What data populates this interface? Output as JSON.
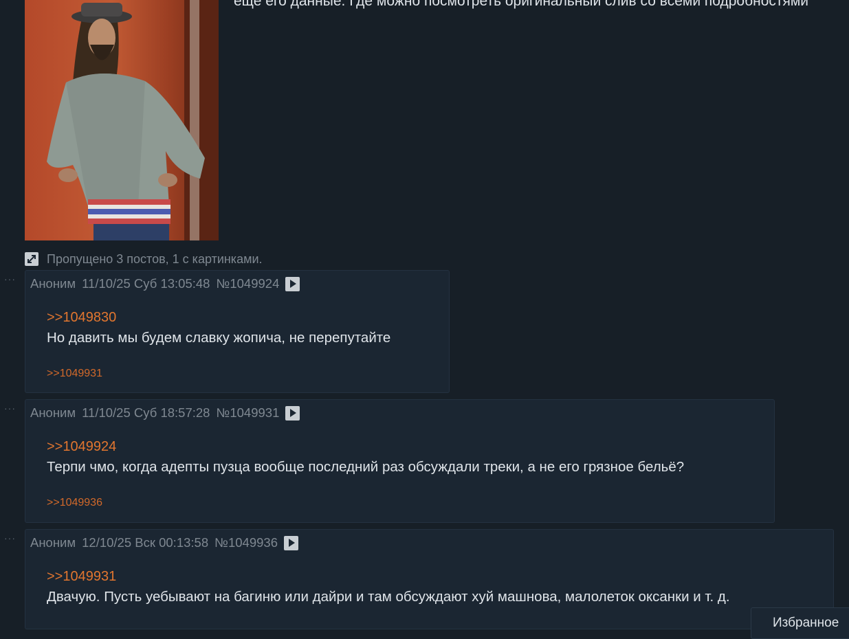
{
  "thread": {
    "op_text": "еще его данные. Где можно посмотреть оригинальный слив со всеми подробностями",
    "omitted_text": "Пропущено 3 постов, 1 с картинками."
  },
  "posts": [
    {
      "author": "Аноним",
      "date": "11/10/25 Суб 13:05:48",
      "number": "№1049924",
      "quote": ">>1049830",
      "body": "Но давить мы будем славку жопича, не перепутайте",
      "reply": ">>1049931"
    },
    {
      "author": "Аноним",
      "date": "11/10/25 Суб 18:57:28",
      "number": "№1049931",
      "quote": ">>1049924",
      "body": "Терпи чмо, когда адепты пузца вообще последний раз обсуждали треки, а не его грязное бельё?",
      "reply": ">>1049936"
    },
    {
      "author": "Аноним",
      "date": "12/10/25 Вск 00:13:58",
      "number": "№1049936",
      "quote": ">>1049931",
      "body": "Двачую. Пусть уебывают на багиню или дайри и там обсуждают хуй машнова, малолеток оксанки и т. д."
    }
  ],
  "favorites": {
    "label": "Избранное"
  },
  "icons": {
    "expand": "expand-icon",
    "play": "play-icon",
    "more": "more-dots-icon"
  },
  "colors": {
    "background": "#171f27",
    "post_background": "#1b2632",
    "link": "#e2762f",
    "text": "#dfe4e9",
    "meta": "#7f8891"
  }
}
